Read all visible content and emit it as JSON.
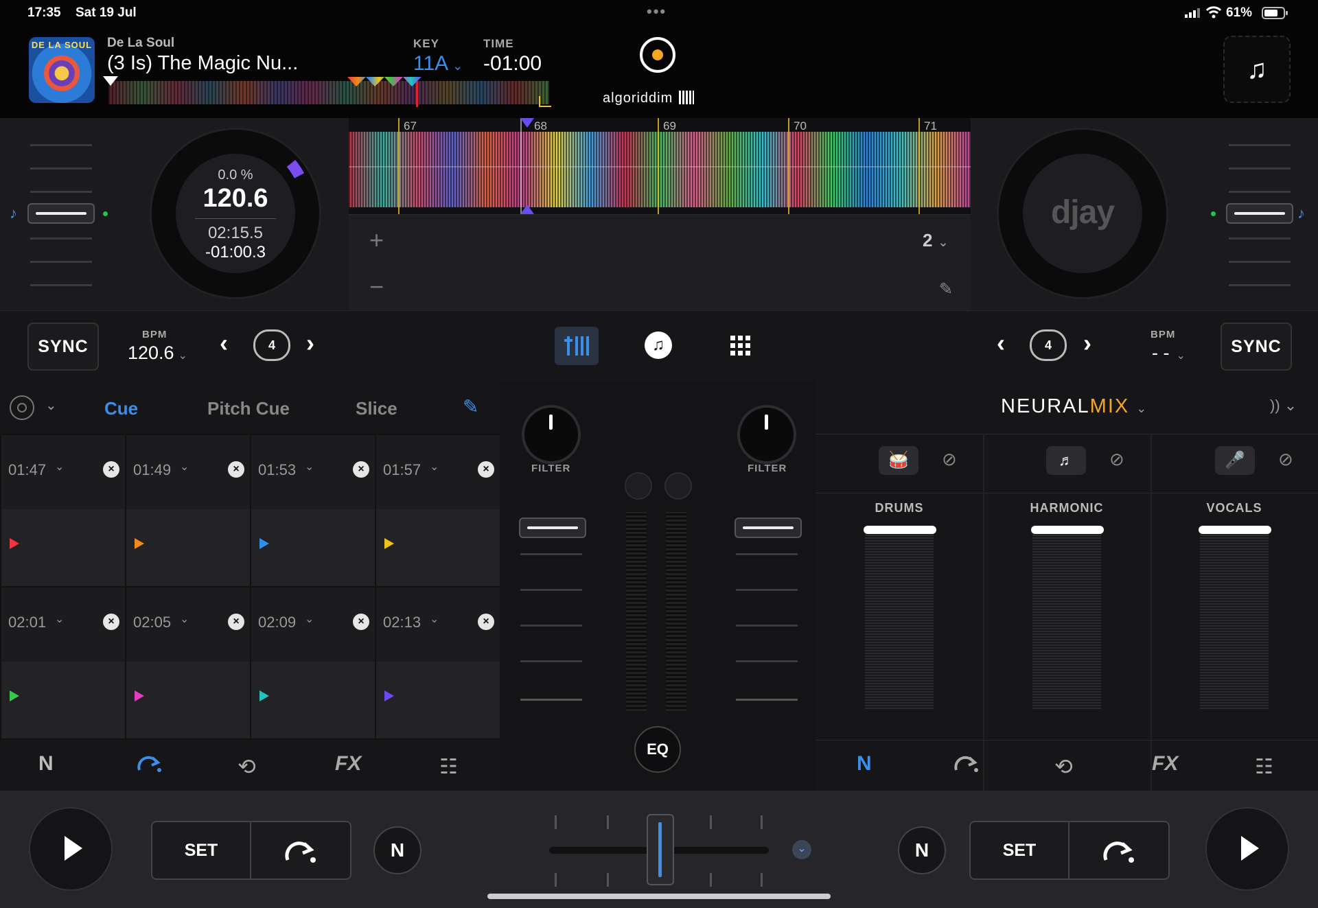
{
  "status": {
    "time": "17:35",
    "date": "Sat 19 Jul",
    "battery": "61%"
  },
  "track": {
    "artist": "De La Soul",
    "title": "(3 Is) The Magic Nu...",
    "art_text": "DE LA SOUL",
    "key_label": "KEY",
    "key": "11A",
    "time_label": "TIME",
    "time": "-01:00"
  },
  "brand": {
    "name": "algoriddim",
    "right_platter_logo": "djay"
  },
  "deck_a": {
    "pitch": "0.0 %",
    "bpm_big": "120.6",
    "elapsed": "02:15.5",
    "remaining": "-01:00.3",
    "sync": "SYNC",
    "bpm_label": "BPM",
    "bpm": "120.6",
    "loop_size": "4"
  },
  "deck_b": {
    "sync": "SYNC",
    "bpm_label": "BPM",
    "bpm": "- -",
    "loop_size": "4"
  },
  "waveform": {
    "beats": [
      "67",
      "68",
      "69",
      "70",
      "71"
    ],
    "loop_count": "2",
    "plus": "+",
    "minus": "−"
  },
  "pads": {
    "tabs": [
      "Cue",
      "Pitch Cue",
      "Slice"
    ],
    "active_tab": "Cue",
    "cues": [
      {
        "time": "01:47",
        "color": "#f0353f"
      },
      {
        "time": "01:49",
        "color": "#f08a1c"
      },
      {
        "time": "01:53",
        "color": "#2e8ff0"
      },
      {
        "time": "01:57",
        "color": "#f0c21c"
      },
      {
        "time": "02:01",
        "color": "#38c94a"
      },
      {
        "time": "02:05",
        "color": "#e040c0"
      },
      {
        "time": "02:09",
        "color": "#22c4c0"
      },
      {
        "time": "02:13",
        "color": "#6a4cf0"
      }
    ]
  },
  "mixer": {
    "filter_left": "FILTER",
    "filter_right": "FILTER",
    "eq": "EQ"
  },
  "neuralmix": {
    "title_a": "NEURAL",
    "title_b": "MIX",
    "accent": "#f5a623",
    "stems": [
      "DRUMS",
      "HARMONIC",
      "VOCALS"
    ]
  },
  "bottom_left_icons": [
    "N",
    "cue-arrow",
    "loop",
    "FX",
    "mixer"
  ],
  "bottom_right_icons": [
    "N",
    "cue-arrow",
    "loop",
    "FX",
    "mixer"
  ],
  "bottom": {
    "set_left": "SET",
    "set_right": "SET",
    "n_left": "N",
    "n_right": "N"
  },
  "colors": {
    "accent_blue": "#3b8eea",
    "background": "#131315"
  }
}
